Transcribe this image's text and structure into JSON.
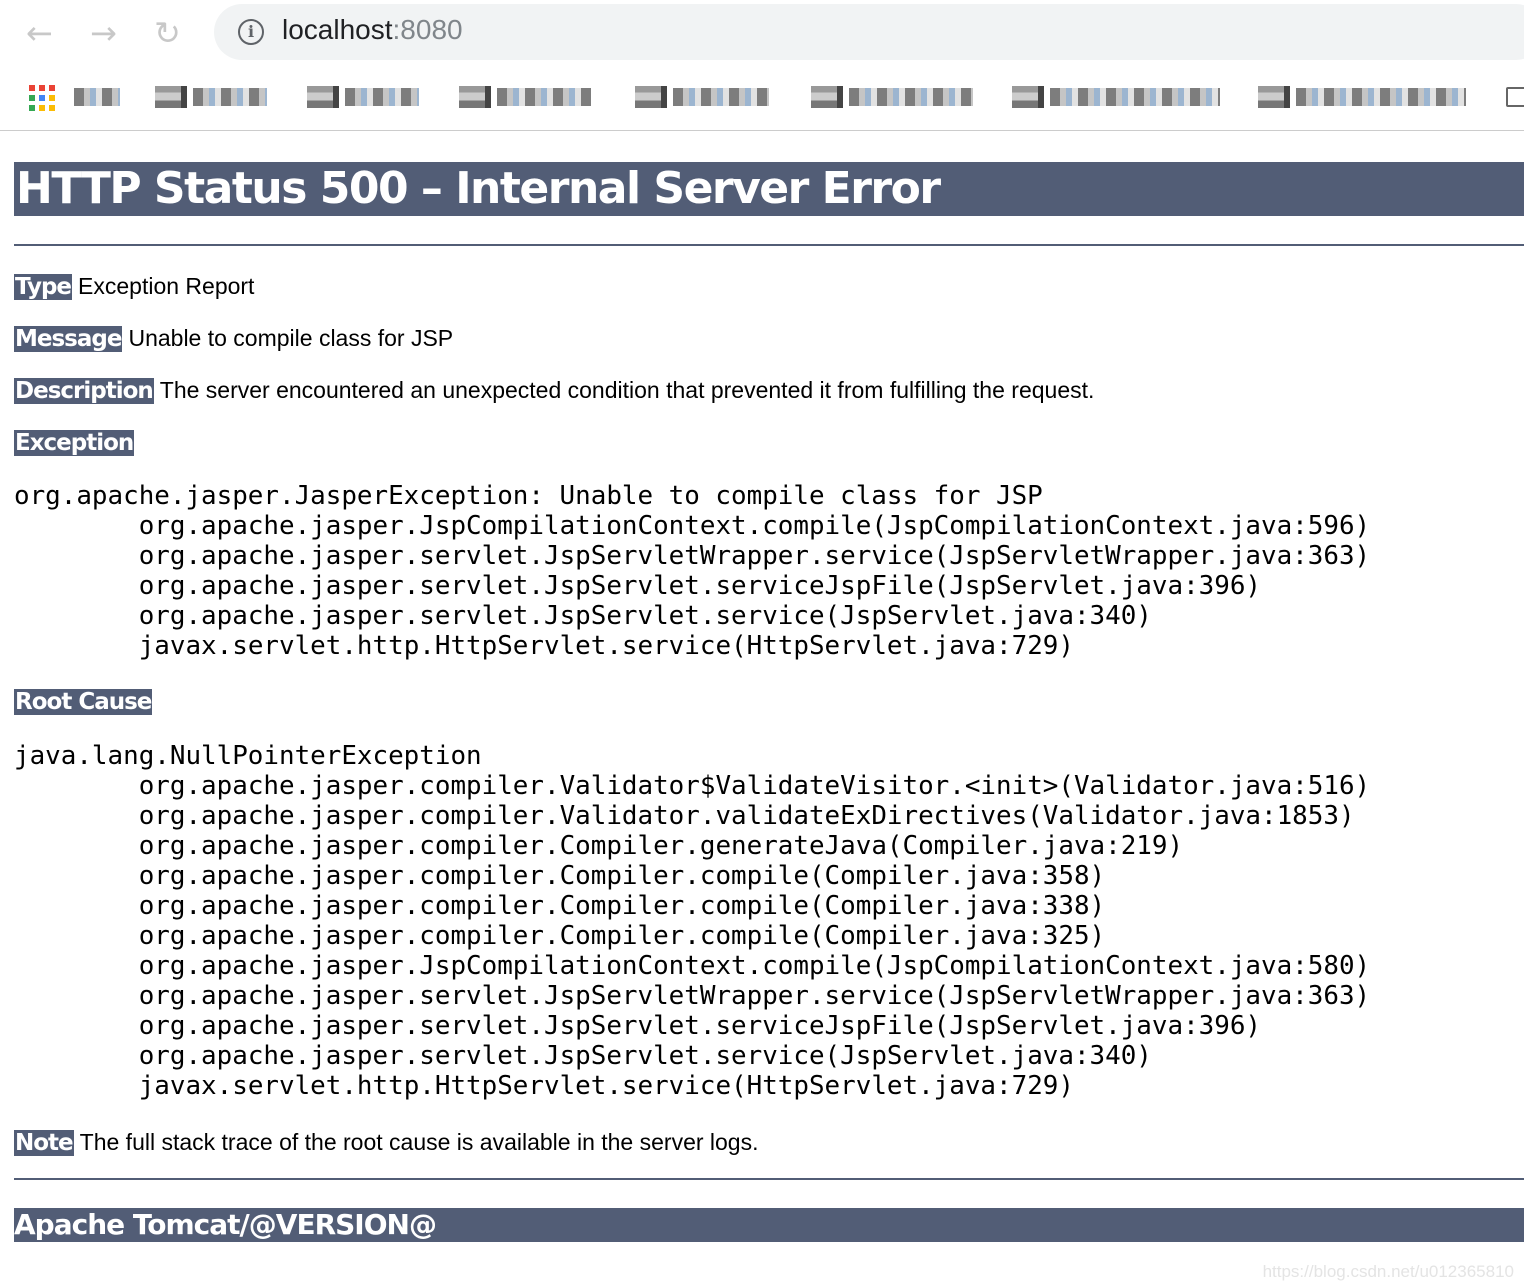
{
  "browser": {
    "url_host": "localhost",
    "url_port": ":8080",
    "icons": [
      "back-arrow-icon",
      "forward-arrow-icon",
      "reload-icon",
      "info-icon",
      "apps-grid-icon",
      "folder-icon"
    ]
  },
  "page": {
    "title": "HTTP Status 500 – Internal Server Error",
    "type_label": "Type",
    "type_value": "Exception Report",
    "message_label": "Message",
    "message_value": "Unable to compile class for JSP",
    "description_label": "Description",
    "description_value": "The server encountered an unexpected condition that prevented it from fulfilling the request.",
    "exception_label": "Exception",
    "exception_trace": "org.apache.jasper.JasperException: Unable to compile class for JSP\n\torg.apache.jasper.JspCompilationContext.compile(JspCompilationContext.java:596)\n\torg.apache.jasper.servlet.JspServletWrapper.service(JspServletWrapper.java:363)\n\torg.apache.jasper.servlet.JspServlet.serviceJspFile(JspServlet.java:396)\n\torg.apache.jasper.servlet.JspServlet.service(JspServlet.java:340)\n\tjavax.servlet.http.HttpServlet.service(HttpServlet.java:729)",
    "root_cause_label": "Root Cause",
    "root_cause_trace": "java.lang.NullPointerException\n\torg.apache.jasper.compiler.Validator$ValidateVisitor.<init>(Validator.java:516)\n\torg.apache.jasper.compiler.Validator.validateExDirectives(Validator.java:1853)\n\torg.apache.jasper.compiler.Compiler.generateJava(Compiler.java:219)\n\torg.apache.jasper.compiler.Compiler.compile(Compiler.java:358)\n\torg.apache.jasper.compiler.Compiler.compile(Compiler.java:338)\n\torg.apache.jasper.compiler.Compiler.compile(Compiler.java:325)\n\torg.apache.jasper.JspCompilationContext.compile(JspCompilationContext.java:580)\n\torg.apache.jasper.servlet.JspServletWrapper.service(JspServletWrapper.java:363)\n\torg.apache.jasper.servlet.JspServlet.serviceJspFile(JspServlet.java:396)\n\torg.apache.jasper.servlet.JspServlet.service(JspServlet.java:340)\n\tjavax.servlet.http.HttpServlet.service(HttpServlet.java:729)",
    "note_label": "Note",
    "note_value": "The full stack trace of the root cause is available in the server logs.",
    "footer": "Apache Tomcat/@VERSION@"
  },
  "watermark": "https://blog.csdn.net/u012365810",
  "colors": {
    "header_bg": "#525d76",
    "header_text": "#ffffff"
  }
}
